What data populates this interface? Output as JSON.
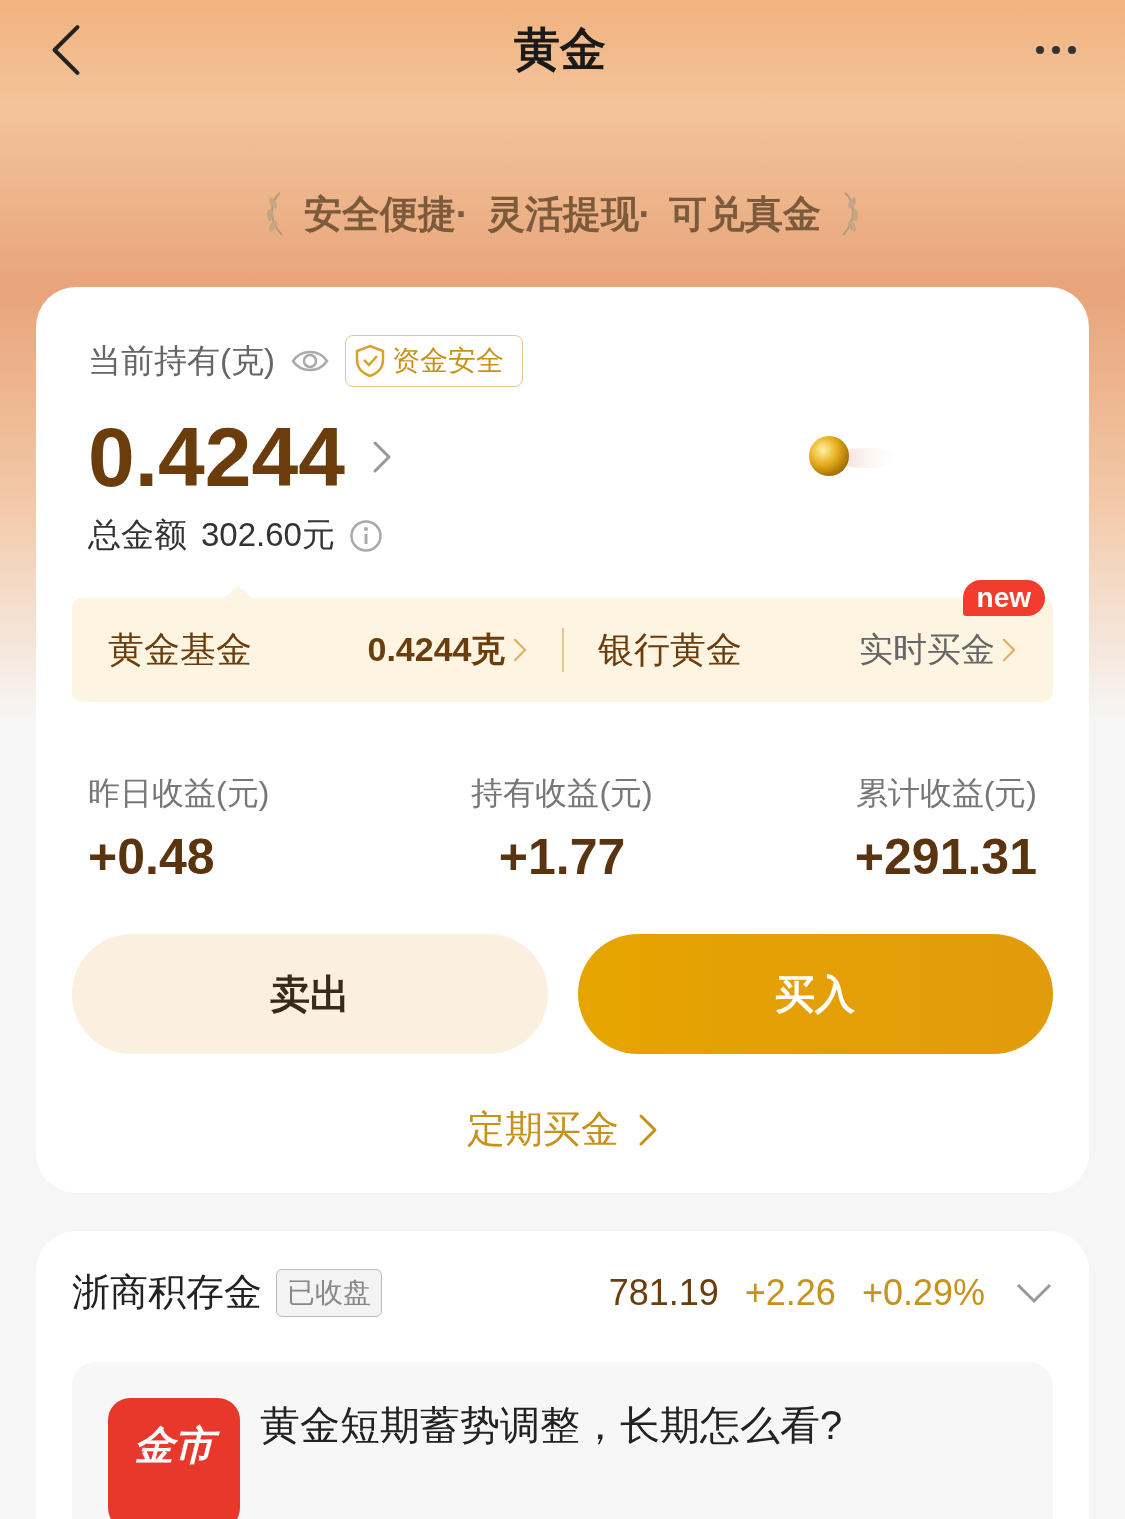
{
  "header": {
    "title": "黄金"
  },
  "slogan": [
    "安全便捷·",
    "灵活提现·",
    "可兑真金"
  ],
  "holding": {
    "label": "当前持有(克)",
    "badge": "资金安全",
    "amount": "0.4244",
    "total_label": "总金额",
    "total_value": "302.60元"
  },
  "segments": [
    {
      "label": "黄金基金",
      "value": "0.4244克",
      "selected": true
    },
    {
      "label": "银行黄金",
      "value": "实时买金",
      "selected": false,
      "badge": "new"
    }
  ],
  "stats": [
    {
      "label": "昨日收益(元)",
      "value": "+0.48"
    },
    {
      "label": "持有收益(元)",
      "value": "+1.77"
    },
    {
      "label": "累计收益(元)",
      "value": "+291.31"
    }
  ],
  "buttons": [
    {
      "label": "卖出",
      "kind": "secondary"
    },
    {
      "label": "买入",
      "kind": "primary"
    }
  ],
  "link": "定期买金",
  "market": {
    "name": "浙商积存金",
    "status": "已收盘",
    "price": "781.19",
    "change": "+2.26",
    "change_pct": "+0.29%"
  },
  "news": [
    {
      "source": "金市",
      "title": "黄金短期蓄势调整，长期怎么看?"
    }
  ]
}
